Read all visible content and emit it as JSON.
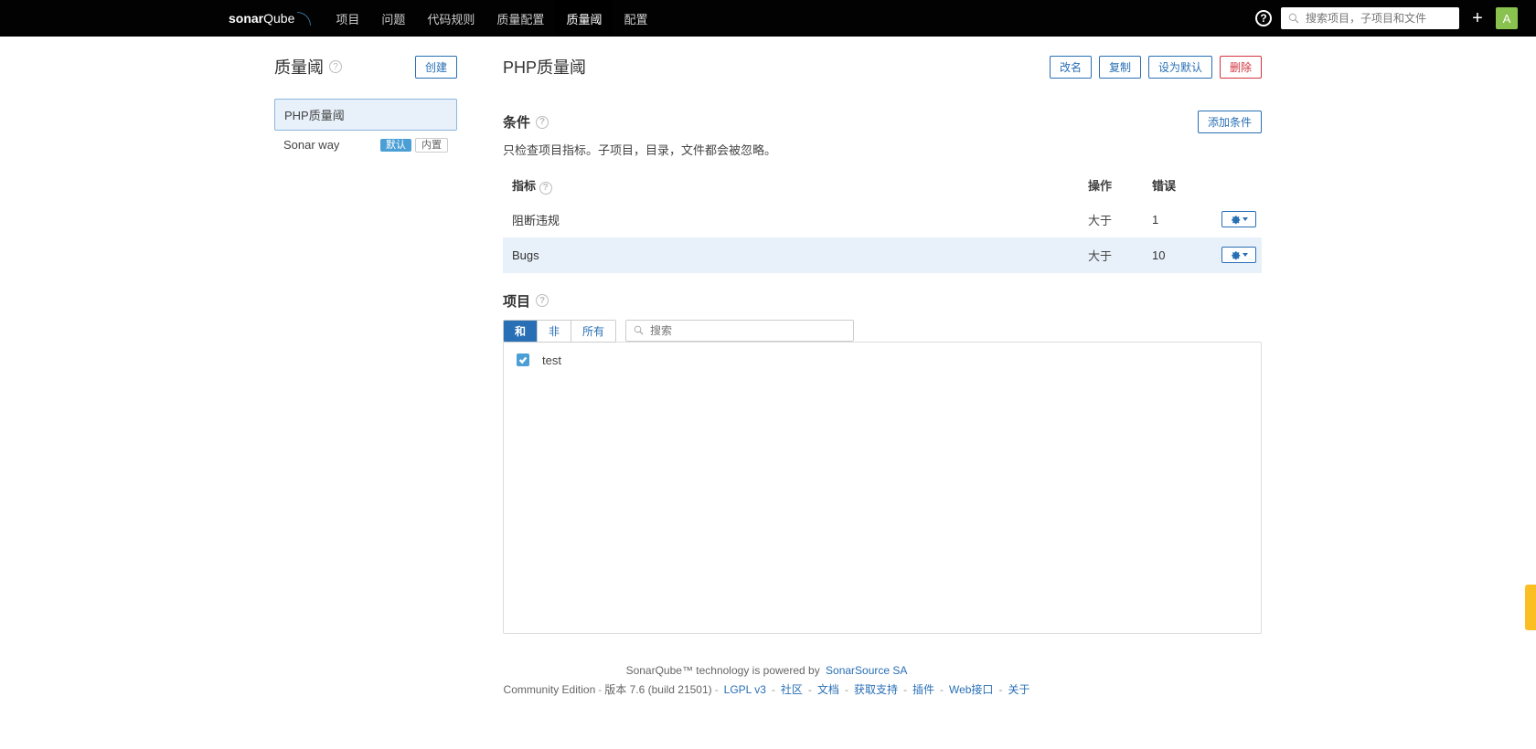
{
  "nav": {
    "logo_a": "sonar",
    "logo_b": "Qube",
    "items": [
      "项目",
      "问题",
      "代码规则",
      "质量配置",
      "质量阈",
      "配置"
    ],
    "active_index": 4
  },
  "topbar": {
    "search_placeholder": "搜索项目，子项目和文件",
    "avatar_letter": "A",
    "help": "?"
  },
  "sidebar": {
    "title": "质量阈",
    "create": "创建",
    "gates": [
      {
        "name": "PHP质量阈",
        "active": true,
        "badges": []
      },
      {
        "name": "Sonar way",
        "active": false,
        "badges": [
          {
            "text": "默认",
            "style": "blue"
          },
          {
            "text": "内置",
            "style": "gray"
          }
        ]
      }
    ]
  },
  "detail": {
    "title": "PHP质量阈",
    "actions": {
      "rename": "改名",
      "copy": "复制",
      "set_default": "设为默认",
      "delete": "删除"
    },
    "conditions": {
      "heading": "条件",
      "desc": "只检查项目指标。子项目，目录，文件都会被忽略。",
      "add": "添加条件",
      "columns": {
        "metric": "指标",
        "op": "操作",
        "err": "错误"
      },
      "rows": [
        {
          "metric": "阻断违规",
          "op": "大于",
          "err": "1",
          "hl": false
        },
        {
          "metric": "Bugs",
          "op": "大于",
          "err": "10",
          "hl": true
        }
      ]
    },
    "projects": {
      "heading": "项目",
      "tabs": {
        "with": "和",
        "without": "非",
        "all": "所有",
        "active": "with"
      },
      "search_placeholder": "搜索",
      "items": [
        {
          "name": "test",
          "checked": true
        }
      ]
    }
  },
  "footer": {
    "line1_a": "SonarQube™ technology is powered by ",
    "line1_link": "SonarSource SA",
    "edition": "Community Edition",
    "version": "版本 7.6 (build 21501)",
    "links": [
      "LGPL v3",
      "社区",
      "文档",
      "获取支持",
      "插件",
      "Web接口",
      "关于"
    ]
  }
}
